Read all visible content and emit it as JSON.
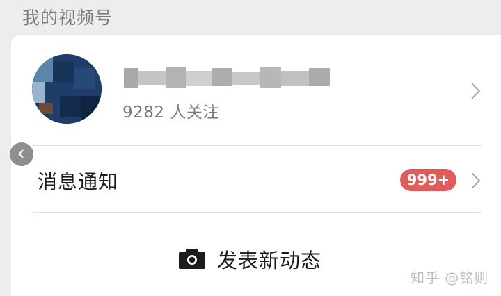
{
  "header": {
    "section_title": "我的视频号"
  },
  "profile": {
    "follower_count": "9282 人关注",
    "avatar_icon": "avatar-pixelated",
    "name_redacted": true
  },
  "notifications": {
    "label": "消息通知",
    "badge": "999+",
    "badge_color": "#e25b5b"
  },
  "post": {
    "label": "发表新动态",
    "icon": "camera-icon"
  },
  "watermark": "知乎 @铭则"
}
